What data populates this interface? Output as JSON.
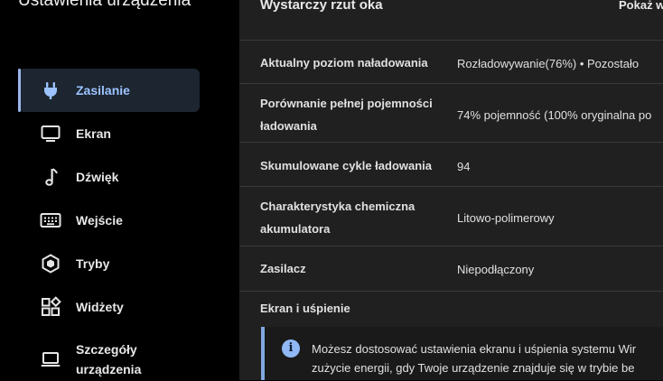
{
  "app": {
    "title": "Ustawienia urządzenia"
  },
  "sidebar": {
    "items": [
      {
        "label": "Zasilanie",
        "icon": "plug-icon",
        "active": true
      },
      {
        "label": "Ekran",
        "icon": "monitor-icon"
      },
      {
        "label": "Dźwięk",
        "icon": "music-note-icon"
      },
      {
        "label": "Wejście",
        "icon": "keyboard-icon"
      },
      {
        "label": "Tryby",
        "icon": "hexagon-icon"
      },
      {
        "label": "Widżety",
        "icon": "widgets-icon"
      },
      {
        "label": "Szczegóły urządzenia",
        "icon": "laptop-icon"
      }
    ]
  },
  "main": {
    "glance_title": "Wystarczy rzut oka",
    "show_more": "Pokaż w",
    "rows": [
      {
        "label": "Aktualny poziom naładowania",
        "value": "Rozładowywanie(76%)  •  Pozostało"
      },
      {
        "label": "Porównanie pełnej pojemności ładowania",
        "value": "74% pojemność (100% oryginalna po"
      },
      {
        "label": "Skumulowane cykle ładowania",
        "value": "94"
      },
      {
        "label": "Charakterystyka chemiczna akumulatora",
        "value": "Litowo-polimerowy"
      },
      {
        "label": "Zasilacz",
        "value": "Niepodłączony"
      }
    ],
    "section_title": "Ekran i uśpienie",
    "info": {
      "icon": "info-icon",
      "line1": "Możesz dostosować ustawienia ekranu i uśpienia systemu Wir",
      "line2": "zużycie energii, gdy Twoje urządzenie znajduje się w trybie be"
    }
  }
}
